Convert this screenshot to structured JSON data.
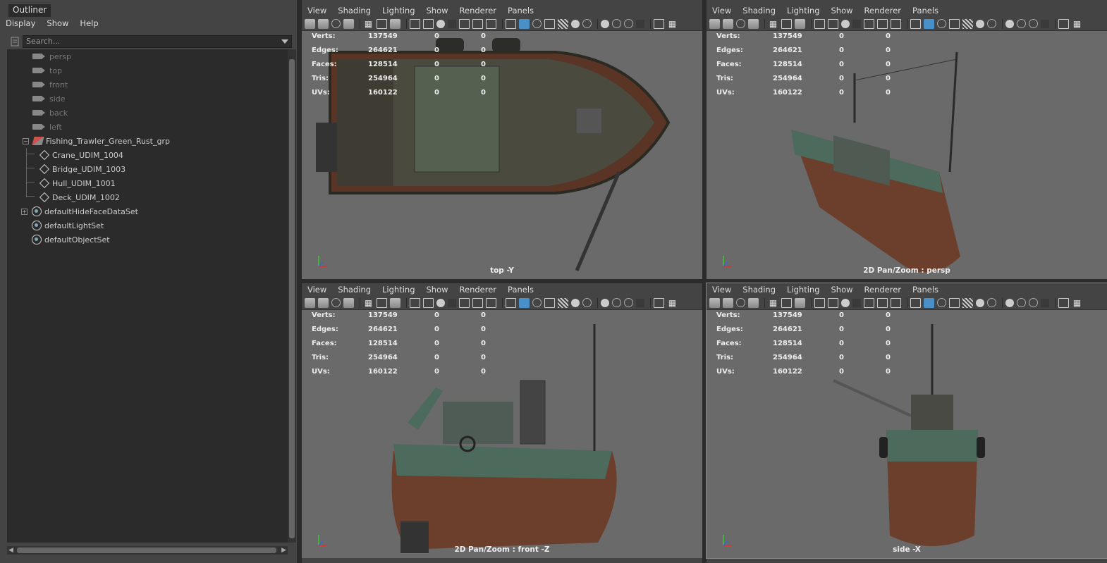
{
  "outliner": {
    "title": "Outliner",
    "menu": [
      "Display",
      "Show",
      "Help"
    ],
    "search_placeholder": "Search...",
    "items": [
      {
        "label": "persp",
        "type": "camera",
        "dim": true
      },
      {
        "label": "top",
        "type": "camera",
        "dim": true
      },
      {
        "label": "front",
        "type": "camera",
        "dim": true
      },
      {
        "label": "side",
        "type": "camera",
        "dim": true
      },
      {
        "label": "back",
        "type": "camera",
        "dim": true
      },
      {
        "label": "left",
        "type": "camera",
        "dim": true
      },
      {
        "label": "Fishing_Trawler_Green_Rust_grp",
        "type": "group",
        "expanded": true
      },
      {
        "label": "Crane_UDIM_1004",
        "type": "mesh",
        "child": true
      },
      {
        "label": "Bridge_UDIM_1003",
        "type": "mesh",
        "child": true
      },
      {
        "label": "Hull_UDIM_1001",
        "type": "mesh",
        "child": true
      },
      {
        "label": "Deck_UDIM_1002",
        "type": "mesh",
        "child": true
      },
      {
        "label": "defaultHideFaceDataSet",
        "type": "set",
        "collapsed": true
      },
      {
        "label": "defaultLightSet",
        "type": "set"
      },
      {
        "label": "defaultObjectSet",
        "type": "set"
      }
    ]
  },
  "viewport_menu": [
    "View",
    "Shading",
    "Lighting",
    "Show",
    "Renderer",
    "Panels"
  ],
  "hud": {
    "rows": [
      {
        "label": "Verts:",
        "v1": "137549",
        "v2": "0",
        "v3": "0"
      },
      {
        "label": "Edges:",
        "v1": "264621",
        "v2": "0",
        "v3": "0"
      },
      {
        "label": "Faces:",
        "v1": "128514",
        "v2": "0",
        "v3": "0"
      },
      {
        "label": "Tris:",
        "v1": "254964",
        "v2": "0",
        "v3": "0"
      },
      {
        "label": "UVs:",
        "v1": "160122",
        "v2": "0",
        "v3": "0"
      }
    ]
  },
  "viewports": [
    {
      "id": "top",
      "camera_label": "top -Y"
    },
    {
      "id": "persp",
      "camera_label": "2D Pan/Zoom : persp"
    },
    {
      "id": "front",
      "camera_label": "2D Pan/Zoom : front -Z"
    },
    {
      "id": "side",
      "camera_label": "side -X"
    }
  ],
  "colors": {
    "panel_bg": "#444444",
    "viewport_bg": "#6a6a6a",
    "hull_rust": "#6b3f2c",
    "hull_green": "#4c6b5c",
    "accent_blue": "#4a90c8"
  }
}
